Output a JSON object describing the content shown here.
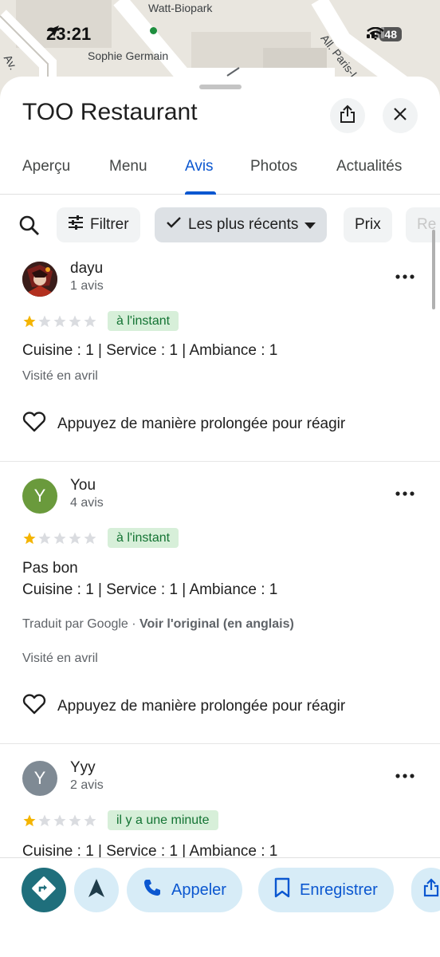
{
  "status_bar": {
    "time": "23:21",
    "battery": "48"
  },
  "map": {
    "labels": [
      "Watt-Biopark",
      "Sophie Germain",
      "All. Paris-I",
      "Av."
    ]
  },
  "place": {
    "title": "TOO Restaurant"
  },
  "tabs": [
    "Aperçu",
    "Menu",
    "Avis",
    "Photos",
    "Actualités"
  ],
  "active_tab": "Avis",
  "filters": {
    "filter_label": "Filtrer",
    "sort_label": "Les plus récents",
    "price_label": "Prix",
    "partial_label": "Re"
  },
  "reviews": [
    {
      "name": "dayu",
      "count": "1 avis",
      "rating": 1,
      "time": "à l'instant",
      "text": "",
      "ratings_line": "Cuisine : 1 | Service : 1 | Ambiance : 1",
      "translated_prefix": "",
      "translated_link": "",
      "visited": "Visité en avril",
      "react": "Appuyez de manière prolongée pour réagir"
    },
    {
      "name": "You",
      "initial": "Y",
      "count": "4 avis",
      "rating": 1,
      "time": "à l'instant",
      "text": "Pas bon",
      "ratings_line": "Cuisine : 1 | Service : 1 | Ambiance : 1",
      "translated_prefix": "Traduit par Google · ",
      "translated_link": "Voir l'original (en anglais)",
      "visited": "Visité en avril",
      "react": "Appuyez de manière prolongée pour réagir"
    },
    {
      "name": "Yyy",
      "initial": "Y",
      "count": "2 avis",
      "rating": 1,
      "time": "il y a une minute",
      "ratings_line": "Cuisine : 1 | Service : 1 | Ambiance : 1"
    }
  ],
  "actions": {
    "call": "Appeler",
    "save": "Enregistrer"
  },
  "colors": {
    "accent": "#0b57d0",
    "star": "#f4b400",
    "badge_bg": "#d7efd9",
    "avatar_you": "#6a9a3c",
    "avatar_yyy": "#7f8a94"
  }
}
